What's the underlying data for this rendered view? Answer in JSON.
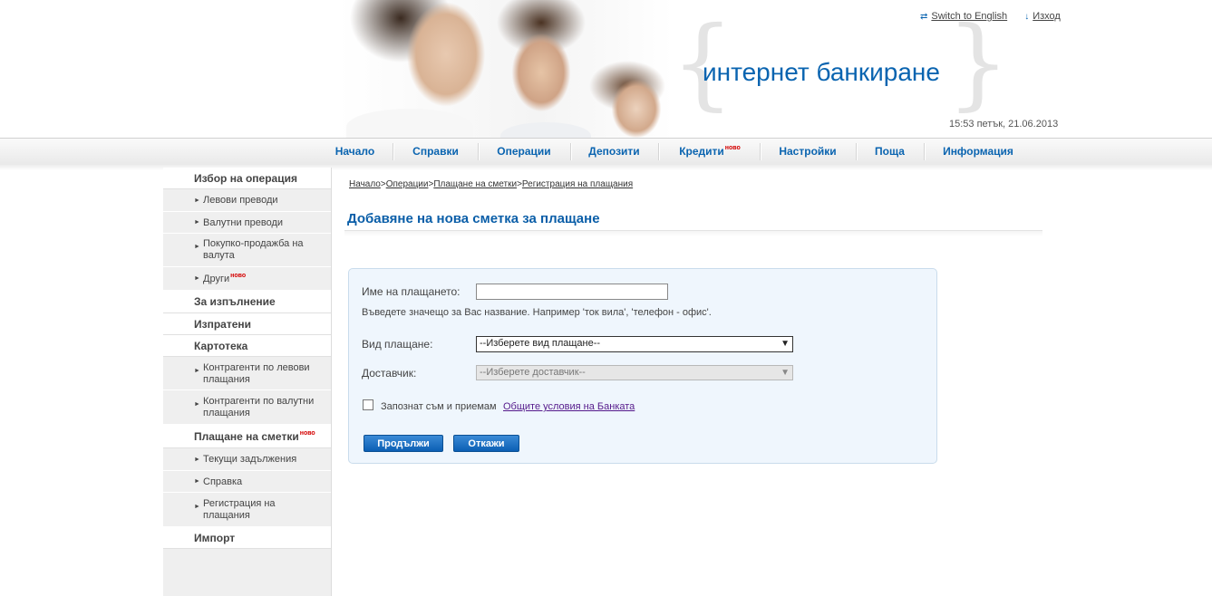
{
  "header": {
    "brand": "интернет банкиране",
    "switch_lang": "Switch to English",
    "logout": "Изход",
    "datetime": "15:53 петък, 21.06.2013",
    "icons": [
      "swap-icon",
      "arrow-down-icon"
    ]
  },
  "nav": {
    "items": [
      "Начало",
      "Справки",
      "Операции",
      "Депозити",
      "Кредити",
      "Настройки",
      "Поща",
      "Информация"
    ],
    "new_badge": "ново"
  },
  "sidebar": {
    "items": [
      {
        "type": "head",
        "label": "Избор на операция"
      },
      {
        "type": "sub",
        "label": "Левови преводи"
      },
      {
        "type": "sub",
        "label": "Валутни преводи"
      },
      {
        "type": "sub",
        "label": "Покупко-продажба на валута"
      },
      {
        "type": "sub",
        "label": "Други",
        "badge": "ново"
      },
      {
        "type": "head",
        "label": "За изпълнение"
      },
      {
        "type": "head",
        "label": "Изпратени"
      },
      {
        "type": "head",
        "label": "Картотека"
      },
      {
        "type": "sub",
        "label": "Контрагенти по левови плащания"
      },
      {
        "type": "sub",
        "label": "Контрагенти по валутни плащания"
      },
      {
        "type": "head",
        "label": "Плащане на сметки",
        "badge": "ново"
      },
      {
        "type": "sub",
        "label": "Текущи задължения"
      },
      {
        "type": "sub",
        "label": "Справка"
      },
      {
        "type": "sub",
        "label": "Регистрация на плащания"
      },
      {
        "type": "head",
        "label": "Импорт"
      }
    ]
  },
  "breadcrumb": [
    "Начало",
    "Операции",
    "Плащане на сметки",
    "Регистрация на плащания"
  ],
  "breadcrumb_sep": ">",
  "page_title": "Добавяне на нова сметка за плащане",
  "form": {
    "name_label": "Име на плащането:",
    "name_value": "",
    "name_hint": "Въведете значещо за Вас название. Например 'ток вила', 'телефон - офис'.",
    "type_label": "Вид плащане:",
    "type_value": "--Изберете вид плащане--",
    "supplier_label": "Доставчик:",
    "supplier_value": "--Изберете доставчик--",
    "terms_text": "Запознат съм и приемам",
    "terms_link": "Общите условия на Банката",
    "terms_checked": false,
    "continue_button": "Продължи",
    "cancel_button": "Откажи"
  },
  "colors": {
    "accent": "#0a64b0",
    "badge": "#d40000",
    "form_bg": "#eff6fd",
    "sidebar_bg": "#efefef"
  }
}
